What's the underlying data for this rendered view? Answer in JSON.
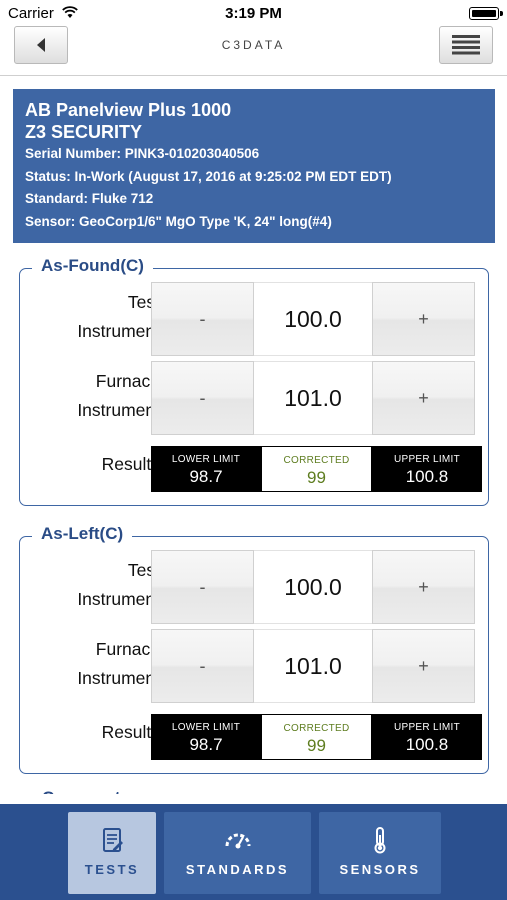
{
  "status_bar": {
    "carrier": "Carrier",
    "time": "3:19 PM"
  },
  "nav": {
    "title": "C3Data"
  },
  "header": {
    "line1": "AB Panelview Plus 1000",
    "line2": "Z3 SECURITY",
    "serial": "Serial Number: PINK3-010203040506",
    "status": "Status: In-Work (August 17, 2016 at 9:25:02 PM EDT EDT)",
    "standard": "Standard: Fluke 712",
    "sensor": "Sensor: GeoCorp1/6\" MgO Type 'K, 24\" long(#4)"
  },
  "as_found": {
    "title": "As-Found(C)",
    "test_label_1": "Test",
    "test_label_2": "Instrument",
    "test_value": "100.0",
    "furnace_label_1": "Furnace",
    "furnace_label_2": "Instrument",
    "furnace_value": "101.0",
    "results_label": "Results",
    "lower_caption": "LOWER LIMIT",
    "lower_value": "98.7",
    "corrected_caption": "CORRECTED",
    "corrected_value": "99",
    "upper_caption": "UPPER LIMIT",
    "upper_value": "100.8"
  },
  "as_left": {
    "title": "As-Left(C)",
    "test_label_1": "Test",
    "test_label_2": "Instrument",
    "test_value": "100.0",
    "furnace_label_1": "Furnace",
    "furnace_label_2": "Instrument",
    "furnace_value": "101.0",
    "results_label": "Results",
    "lower_caption": "LOWER LIMIT",
    "lower_value": "98.7",
    "corrected_caption": "CORRECTED",
    "corrected_value": "99",
    "upper_caption": "UPPER LIMIT",
    "upper_value": "100.8"
  },
  "buttons": {
    "minus": "-",
    "plus": "+"
  },
  "comment_title": "Comment",
  "tabs": [
    {
      "label": "Tests",
      "icon": "clipboard-icon",
      "active": true
    },
    {
      "label": "Standards",
      "icon": "gauge-icon",
      "active": false
    },
    {
      "label": "Sensors",
      "icon": "thermometer-icon",
      "active": false
    }
  ],
  "colors": {
    "header_blue": "#3e66a4",
    "tabbar_blue": "#2b508f",
    "corrected_green": "#5e7d20"
  }
}
